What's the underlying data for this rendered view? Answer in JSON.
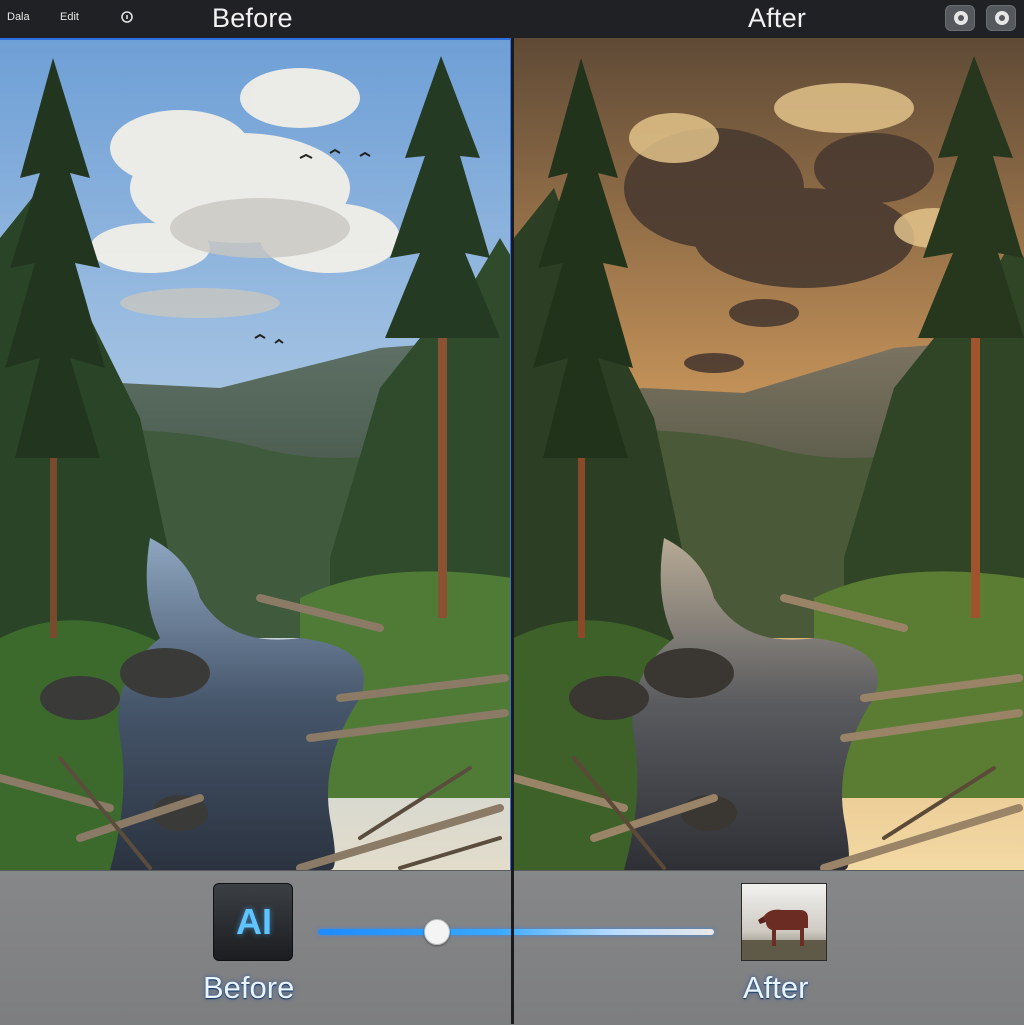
{
  "topbar": {
    "small_label_1": "Dala",
    "small_label_2": "Edit",
    "before_title": "Before",
    "after_title": "After",
    "icon_1": "eye-icon",
    "icon_2": "eye-icon"
  },
  "bottom": {
    "ai_badge": "AI",
    "before_label": "Before",
    "after_label": "After",
    "slider_value": 0.3
  },
  "colors": {
    "accent": "#2f6fe0",
    "ai_text": "#5fc4ff"
  }
}
